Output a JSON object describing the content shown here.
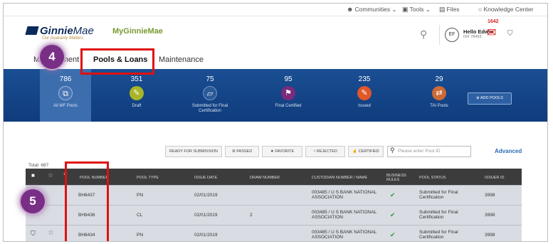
{
  "util_nav": {
    "communities": "Communities",
    "tools": "Tools",
    "files": "Files",
    "knowledge": "Knowledge Center"
  },
  "header": {
    "logo_ginnie": "Ginnie",
    "logo_mae": "Mae",
    "tagline": "Our Guaranty Matters",
    "app_name": "MyGinnieMae",
    "avatar_initials": "EF",
    "user_name": "Hello Edwin",
    "user_sub": "ID# 78493",
    "mail_count": "1642"
  },
  "tabs": {
    "management": "Management",
    "pools_loans": "Pools & Loans",
    "maintenance": "Maintenance"
  },
  "steps": {
    "step4": "4",
    "step5": "5"
  },
  "statuses": [
    {
      "count": "786",
      "label": "All MF Pools",
      "icon": "copy-icon",
      "color": "#4a75b3"
    },
    {
      "count": "351",
      "label": "Draft",
      "icon": "edit-icon",
      "color": "#a8b527"
    },
    {
      "count": "75",
      "label": "Submitted for Final Certification",
      "icon": "inbox-icon",
      "color": "#2c5a99"
    },
    {
      "count": "95",
      "label": "Final Certified",
      "icon": "flag-icon",
      "color": "#7b2b7e"
    },
    {
      "count": "235",
      "label": "Issued",
      "icon": "issued-icon",
      "color": "#e0572a"
    },
    {
      "count": "29",
      "label": "TAI Pools",
      "icon": "transfer-icon",
      "color": "#cc6a35"
    }
  ],
  "add_pools_label": "ADD POOLS",
  "filters": {
    "ready": "READY FOR SUBMISSION",
    "passed": "PASSED",
    "favorite": "FAVORITE",
    "rejected": "REJECTED",
    "certified": "CERTIFIED",
    "search_placeholder": "Please enter Pool ID",
    "advanced": "Advanced"
  },
  "total_label": "Total: 687",
  "table": {
    "headers": [
      "POOL NUMBER",
      "POOL TYPE",
      "ISSUE DATE",
      "DRAW NUMBER",
      "CUSTODIAN NUMBER / NAME",
      "BUSINESS RULES",
      "POOL STATUS",
      "ISSUER ID"
    ],
    "rows": [
      {
        "pool": "BH8437",
        "type": "PN",
        "date": "02/01/2019",
        "draw": "",
        "custodian": "003485 / U S BANK NATIONAL ASSOCIATION",
        "status": "Submitted for Final Certification",
        "issuer": "3998"
      },
      {
        "pool": "BH8436",
        "type": "CL",
        "date": "02/01/2019",
        "draw": "2",
        "custodian": "003485 / U S BANK NATIONAL ASSOCIATION",
        "status": "Submitted for Final Certification",
        "issuer": "3998"
      },
      {
        "pool": "BH8434",
        "type": "PN",
        "date": "02/01/2019",
        "draw": "",
        "custodian": "003485 / U S BANK NATIONAL ASSOCIATION",
        "status": "Submitted for Final Certification",
        "issuer": "3998"
      }
    ]
  }
}
